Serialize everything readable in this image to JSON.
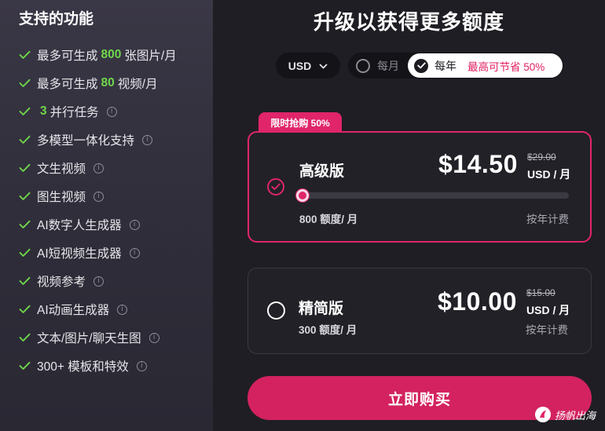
{
  "sidebar": {
    "title": "支持的功能",
    "features": [
      {
        "prefix": "最多可生成",
        "highlight": "800",
        "suffix": "张图片/月",
        "info": false
      },
      {
        "prefix": "最多可生成",
        "highlight": "80",
        "suffix": "视频/月",
        "info": false
      },
      {
        "prefix": "",
        "highlight": "3",
        "suffix": "并行任务",
        "info": true
      },
      {
        "prefix": "多模型一体化支持",
        "highlight": "",
        "suffix": "",
        "info": true
      },
      {
        "prefix": "文生视频",
        "highlight": "",
        "suffix": "",
        "info": true
      },
      {
        "prefix": "图生视频",
        "highlight": "",
        "suffix": "",
        "info": true
      },
      {
        "prefix": "AI数字人生成器",
        "highlight": "",
        "suffix": "",
        "info": true
      },
      {
        "prefix": "AI短视频生成器",
        "highlight": "",
        "suffix": "",
        "info": true
      },
      {
        "prefix": "视频参考",
        "highlight": "",
        "suffix": "",
        "info": true
      },
      {
        "prefix": "AI动画生成器",
        "highlight": "",
        "suffix": "",
        "info": true
      },
      {
        "prefix": "文本/图片/聊天生图",
        "highlight": "",
        "suffix": "",
        "info": true
      },
      {
        "prefix": "300+ 模板和特效",
        "highlight": "",
        "suffix": "",
        "info": true
      }
    ],
    "check_icon": "check-icon",
    "info_icon": "info-icon",
    "check_color": "#6fd64b"
  },
  "header": {
    "title": "升级以获得更多额度"
  },
  "billing": {
    "currency": "USD",
    "monthly_label": "每月",
    "yearly_label": "每年",
    "save_note": "最高可节省 50%",
    "selected": "yearly"
  },
  "plans": {
    "premium": {
      "badge": "限时抢购 50%",
      "name": "高级版",
      "price": "$14.50",
      "old_price": "$29.00",
      "unit": "USD / 月",
      "credits": "800 额度/ 月",
      "billing": "按年计费",
      "selected": true,
      "slider_level": 0
    },
    "basic": {
      "name": "精简版",
      "price": "$10.00",
      "old_price": "$15.00",
      "unit": "USD / 月",
      "credits": "300 额度/ 月",
      "billing": "按年计费",
      "selected": false
    }
  },
  "buy_button": "立即购买",
  "watermark": "扬帆出海",
  "colors": {
    "accent": "#e0256a",
    "button": "#d3225f",
    "highlight_green": "#6fd64b",
    "background": "#1f1e24"
  }
}
